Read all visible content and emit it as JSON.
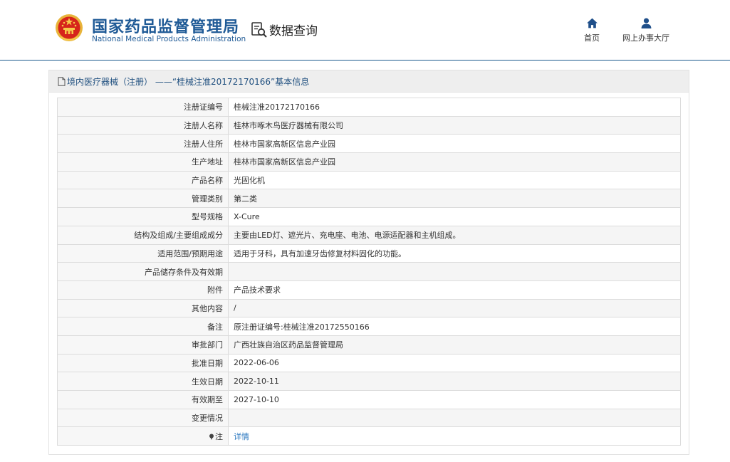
{
  "header": {
    "brand_cn": "国家药品监督管理局",
    "brand_en": "National Medical Products Administration",
    "query_title": "数据查询",
    "nav": [
      {
        "label": "首页",
        "icon": "home-icon"
      },
      {
        "label": "网上办事大厅",
        "icon": "user-icon"
      }
    ]
  },
  "panel": {
    "title": "境内医疗器械（注册） ——“桂械注准20172170166”基本信息",
    "rows": [
      {
        "key": "注册证编号",
        "value": "桂械注准20172170166"
      },
      {
        "key": "注册人名称",
        "value": "桂林市啄木鸟医疗器械有限公司"
      },
      {
        "key": "注册人住所",
        "value": "桂林市国家高新区信息产业园"
      },
      {
        "key": "生产地址",
        "value": "桂林市国家高新区信息产业园"
      },
      {
        "key": "产品名称",
        "value": "光固化机"
      },
      {
        "key": "管理类别",
        "value": "第二类"
      },
      {
        "key": "型号规格",
        "value": "X-Cure"
      },
      {
        "key": "结构及组成/主要组成成分",
        "value": "主要由LED灯、遮光片、充电座、电池、电源适配器和主机组成。"
      },
      {
        "key": "适用范围/预期用途",
        "value": "适用于牙科，具有加速牙齿修复材料固化的功能。"
      },
      {
        "key": "产品储存条件及有效期",
        "value": ""
      },
      {
        "key": "附件",
        "value": "产品技术要求"
      },
      {
        "key": "其他内容",
        "value": "/"
      },
      {
        "key": "备注",
        "value": "原注册证编号:桂械注准20172550166"
      },
      {
        "key": "审批部门",
        "value": "广西壮族自治区药品监督管理局"
      },
      {
        "key": "批准日期",
        "value": "2022-06-06"
      },
      {
        "key": "生效日期",
        "value": "2022-10-11"
      },
      {
        "key": "有效期至",
        "value": "2027-10-10"
      },
      {
        "key": "变更情况",
        "value": ""
      }
    ],
    "note": {
      "key": "注",
      "link": "详情",
      "icon": "pin-icon"
    }
  },
  "colors": {
    "brand_blue": "#1f5a96",
    "header_rule": "#1d5a8e",
    "link": "#2b78c0"
  }
}
